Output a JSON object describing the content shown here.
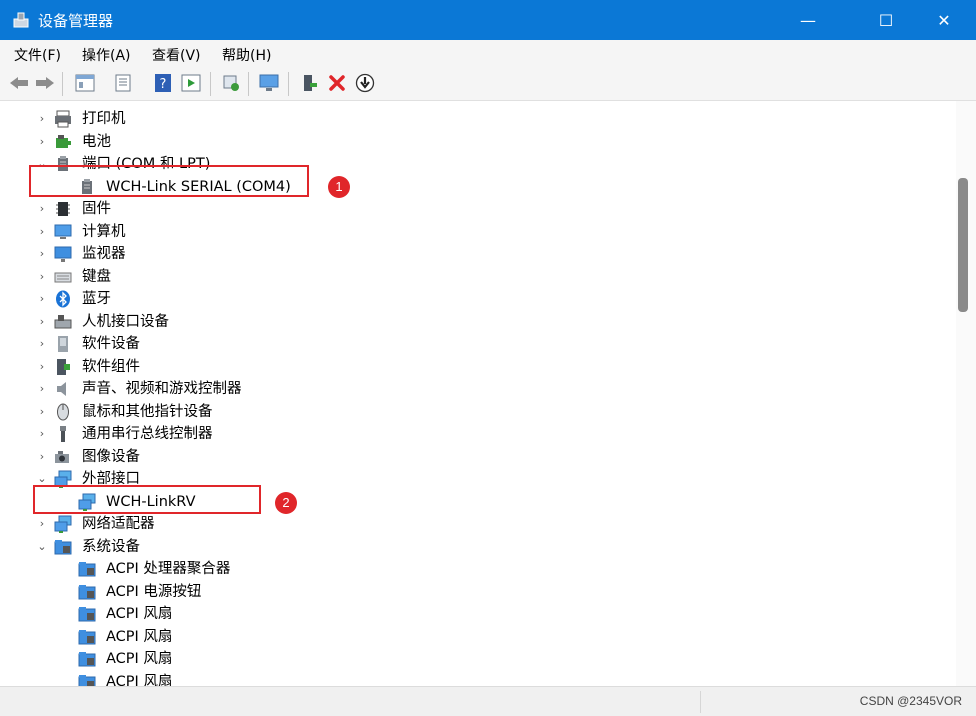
{
  "window": {
    "title": "设备管理器",
    "accent": "#0b78d6",
    "controls": {
      "minimize": "—",
      "maximize": "☐",
      "close": "✕"
    }
  },
  "menu": [
    "文件(F)",
    "操作(A)",
    "查看(V)",
    "帮助(H)"
  ],
  "toolbar": [
    "back-icon",
    "forward-icon",
    "properties-icon",
    "refresh-icon",
    "help-icon",
    "play-icon",
    "scan-hardware-icon",
    "monitor-icon",
    "add-driver-icon",
    "uninstall-icon",
    "download-icon"
  ],
  "tree": [
    {
      "label": "打印机",
      "expander": "›",
      "icon": "printer-icon"
    },
    {
      "label": "电池",
      "expander": "›",
      "icon": "battery-icon"
    },
    {
      "label": "端口 (COM 和 LPT)",
      "expander": "⌄",
      "icon": "port-icon"
    },
    {
      "label": "WCH-Link SERIAL (COM4)",
      "expander": "",
      "icon": "port-icon"
    },
    {
      "label": "固件",
      "expander": "›",
      "icon": "firmware-icon"
    },
    {
      "label": "计算机",
      "expander": "›",
      "icon": "computer-icon"
    },
    {
      "label": "监视器",
      "expander": "›",
      "icon": "monitor-icon"
    },
    {
      "label": "键盘",
      "expander": "›",
      "icon": "keyboard-icon"
    },
    {
      "label": "蓝牙",
      "expander": "›",
      "icon": "bluetooth-icon"
    },
    {
      "label": "人机接口设备",
      "expander": "›",
      "icon": "hid-icon"
    },
    {
      "label": "软件设备",
      "expander": "›",
      "icon": "software-device-icon"
    },
    {
      "label": "软件组件",
      "expander": "›",
      "icon": "software-component-icon"
    },
    {
      "label": "声音、视频和游戏控制器",
      "expander": "›",
      "icon": "speaker-icon"
    },
    {
      "label": "鼠标和其他指针设备",
      "expander": "›",
      "icon": "mouse-icon"
    },
    {
      "label": "通用串行总线控制器",
      "expander": "›",
      "icon": "usb-icon"
    },
    {
      "label": "图像设备",
      "expander": "›",
      "icon": "camera-icon"
    },
    {
      "label": "外部接口",
      "expander": "⌄",
      "icon": "network-icon"
    },
    {
      "label": "WCH-LinkRV",
      "expander": "",
      "icon": "network-icon"
    },
    {
      "label": "网络适配器",
      "expander": "›",
      "icon": "network-icon"
    },
    {
      "label": "系统设备",
      "expander": "⌄",
      "icon": "system-folder-icon"
    },
    {
      "label": "ACPI 处理器聚合器",
      "expander": "",
      "icon": "system-folder-icon"
    },
    {
      "label": "ACPI 电源按钮",
      "expander": "",
      "icon": "system-folder-icon"
    },
    {
      "label": "ACPI 风扇",
      "expander": "",
      "icon": "system-folder-icon"
    },
    {
      "label": "ACPI 风扇",
      "expander": "",
      "icon": "system-folder-icon"
    },
    {
      "label": "ACPI 风扇",
      "expander": "",
      "icon": "system-folder-icon"
    },
    {
      "label": "ACPI 风扇",
      "expander": "",
      "icon": "system-folder-icon"
    }
  ],
  "annotations": [
    {
      "number": "1",
      "color": "#e0262a"
    },
    {
      "number": "2",
      "color": "#e0262a"
    }
  ],
  "status": {
    "watermark": "CSDN @2345VOR"
  }
}
